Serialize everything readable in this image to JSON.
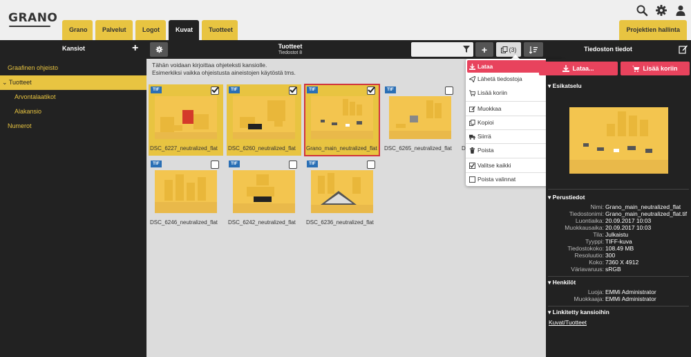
{
  "header": {
    "logo": "GRANO",
    "tabs": [
      {
        "label": "Grano",
        "active": false
      },
      {
        "label": "Palvelut",
        "active": false
      },
      {
        "label": "Logot",
        "active": false
      },
      {
        "label": "Kuvat",
        "active": true
      },
      {
        "label": "Tuotteet",
        "active": false
      }
    ],
    "right_button": "Projektien hallinta",
    "icons": [
      "search-icon",
      "gear-icon",
      "user-icon"
    ]
  },
  "toolbar": {
    "left_title": "Kansiot",
    "center_title": "Tuotteet",
    "center_subtitle": "Tiedostot 8",
    "search_value": "",
    "copy_count": "(3)",
    "right_title": "Tiedoston tiedot"
  },
  "sidebar": {
    "items": [
      {
        "label": "Graafinen ohjeisto",
        "level": 0,
        "active": false
      },
      {
        "label": "Tuotteet",
        "level": 0,
        "active": true,
        "expanded": true
      },
      {
        "label": "Arvontalaatikot",
        "level": 1,
        "active": false
      },
      {
        "label": "Alakansio",
        "level": 1,
        "active": false
      },
      {
        "label": "Numerot",
        "level": 0,
        "active": false
      }
    ]
  },
  "content": {
    "description_line1": "Tähän voidaan kirjoittaa ohjeteksti kansiolle.",
    "description_line2": "Esimerkiksi vaikka ohjeistusta aineistojen käytöstä tms.",
    "files": [
      {
        "name": "DSC_6227_neutralized_flat",
        "type": "TIF",
        "checked": true
      },
      {
        "name": "DSC_6260_neutralized_flat",
        "type": "TIF",
        "checked": true
      },
      {
        "name": "Grano_main_neutralized_flat",
        "type": "TIF",
        "checked": true
      },
      {
        "name": "DSC_6265_neutralized_flat",
        "type": "TIF",
        "checked": false
      },
      {
        "name": "DSC_6246_neutralized_flat",
        "type": "TIF",
        "checked": false
      },
      {
        "name": "DSC_6242_neutralized_flat",
        "type": "TIF",
        "checked": false
      },
      {
        "name": "DSC_6236_neutralized_flat",
        "type": "TIF",
        "checked": false
      }
    ],
    "hidden_partial_label": "D"
  },
  "menu": {
    "items": [
      {
        "label": "Lataa",
        "icon": "download-icon",
        "highlight": true
      },
      {
        "label": "Lähetä tiedostoja",
        "icon": "send-icon"
      },
      {
        "label": "Lisää koriin",
        "icon": "cart-icon"
      },
      {
        "label": "Muokkaa",
        "icon": "edit-icon"
      },
      {
        "label": "Kopioi",
        "icon": "copy-icon"
      },
      {
        "label": "Siirrä",
        "icon": "truck-icon"
      },
      {
        "label": "Poista",
        "icon": "trash-icon"
      },
      {
        "label": "Valitse kaikki",
        "icon": "checkbox-checked-icon"
      },
      {
        "label": "Poista valinnat",
        "icon": "checkbox-empty-icon"
      }
    ]
  },
  "details": {
    "download_button": "Lataa...",
    "cart_button": "Lisää koriin",
    "preview_heading": "Esikatselu",
    "basic_heading": "Perustiedot",
    "basic": [
      {
        "key": "Nimi:",
        "value": "Grano_main_neutralized_flat"
      },
      {
        "key": "Tiedostonimi:",
        "value": "Grano_main_neutralized_flat.tif"
      },
      {
        "key": "Luontiaika:",
        "value": "20.09.2017 10:03"
      },
      {
        "key": "Muokkausaika:",
        "value": "20.09.2017 10:03"
      },
      {
        "key": "Tila:",
        "value": "Julkaistu"
      },
      {
        "key": "Tyyppi:",
        "value": "TIFF-kuva"
      },
      {
        "key": "Tiedostokoko:",
        "value": "108.49 MB"
      },
      {
        "key": "Resoluutio:",
        "value": "300"
      },
      {
        "key": "Koko:",
        "value": "7360 X 4912"
      },
      {
        "key": "Väriavaruus:",
        "value": "sRGB"
      }
    ],
    "people_heading": "Henkilöt",
    "people": [
      {
        "key": "Luoja:",
        "value": "EMMi Administrator"
      },
      {
        "key": "Muokkaaja:",
        "value": "EMMi Administrator"
      }
    ],
    "linked_heading": "Linkitetty kansioihin",
    "linked_path": "Kuvat/Tuotteet"
  },
  "colors": {
    "accent_yellow": "#e8c441",
    "accent_red": "#e8435d",
    "dark_bg": "#222222",
    "content_bg": "#dcdcdc",
    "tif_badge": "#2a6fb5"
  }
}
